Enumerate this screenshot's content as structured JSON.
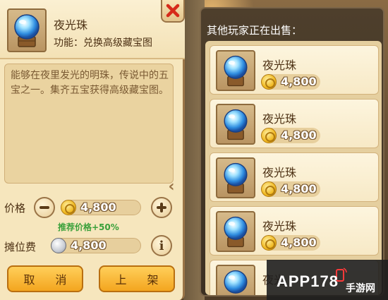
{
  "item": {
    "name": "夜光珠",
    "function_text": "功能：兑换高级藏宝图",
    "description": "能够在夜里发光的明珠，传说中的五宝之一。集齐五宝获得高级藏宝图。",
    "icon": "night-pearl-icon"
  },
  "sell_form": {
    "price_label": "价格",
    "price_value": "4,800",
    "recommend_text": "推荐价格+50%",
    "stall_fee_label": "摊位费",
    "stall_fee_value": "4,800",
    "cancel_label": "取 消",
    "list_label": "上 架"
  },
  "market": {
    "title": "其他玩家正在出售：",
    "listings": [
      {
        "name": "夜光珠",
        "price": "4,800"
      },
      {
        "name": "夜光珠",
        "price": "4,800"
      },
      {
        "name": "夜光珠",
        "price": "4,800"
      },
      {
        "name": "夜光珠",
        "price": "4,800"
      },
      {
        "name": "夜光",
        "price": ""
      }
    ]
  },
  "watermark": {
    "logo": "APP178",
    "sub": "手游网"
  },
  "colors": {
    "panel_bg": "#f6e6bd",
    "accent_green": "#3aa03a",
    "button_orange": "#f3a51f",
    "close_red": "#d62a1a"
  }
}
